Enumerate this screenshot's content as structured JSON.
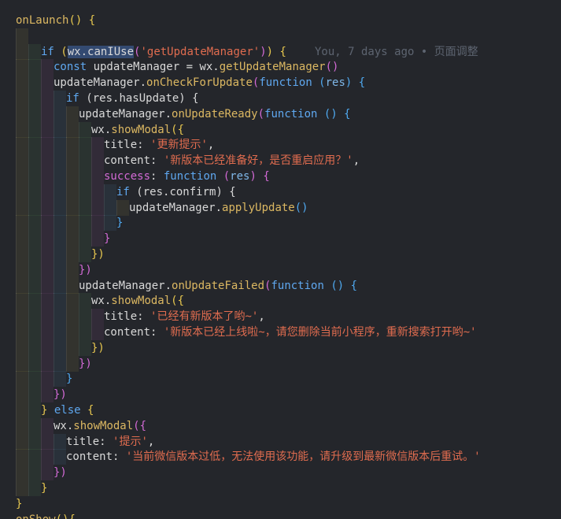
{
  "blame": "You, 7 days ago • 页面调整",
  "lines": [
    [
      [
        "onLaunch",
        "fn"
      ],
      [
        "() {",
        "br1"
      ]
    ],
    [],
    [
      [
        "if ",
        "kw"
      ],
      [
        "(",
        "br1"
      ],
      [
        "wx.canIUse",
        "sel"
      ],
      [
        "(",
        "br2"
      ],
      [
        "'getUpdateManager'",
        "str"
      ],
      [
        ")",
        "br2"
      ],
      [
        ") {",
        "br1"
      ]
    ],
    [
      [
        "const ",
        "kw"
      ],
      [
        "updateManager ",
        "var"
      ],
      [
        "= ",
        "var"
      ],
      [
        "wx.",
        "var"
      ],
      [
        "getUpdateManager",
        "fn"
      ],
      [
        "()",
        "br2"
      ]
    ],
    [
      [
        "updateManager.",
        "var"
      ],
      [
        "onCheckForUpdate",
        "fn"
      ],
      [
        "(",
        "br2"
      ],
      [
        "function ",
        "kw"
      ],
      [
        "(",
        "br3"
      ],
      [
        "res",
        "param"
      ],
      [
        ") {",
        "br3"
      ]
    ],
    [
      [
        "if ",
        "kw"
      ],
      [
        "(res.hasUpdate) {",
        "var"
      ]
    ],
    [
      [
        "updateManager.",
        "var"
      ],
      [
        "onUpdateReady",
        "fn"
      ],
      [
        "(",
        "br2"
      ],
      [
        "function ",
        "kw"
      ],
      [
        "() {",
        "br3"
      ]
    ],
    [
      [
        "wx.",
        "var"
      ],
      [
        "showModal",
        "fn"
      ],
      [
        "({",
        "br1"
      ]
    ],
    [
      [
        "title: ",
        "key"
      ],
      [
        "'更新提示'",
        "str"
      ],
      [
        ",",
        "var"
      ]
    ],
    [
      [
        "content: ",
        "key"
      ],
      [
        "'新版本已经准备好，是否重启应用？'",
        "str"
      ],
      [
        ",",
        "var"
      ]
    ],
    [
      [
        "success",
        "succ"
      ],
      [
        ": ",
        "var"
      ],
      [
        "function ",
        "kw"
      ],
      [
        "(",
        "br2"
      ],
      [
        "res",
        "param"
      ],
      [
        ") {",
        "br2"
      ]
    ],
    [
      [
        "if ",
        "kw"
      ],
      [
        "(res.confirm) {",
        "var"
      ]
    ],
    [
      [
        "updateManager.",
        "var"
      ],
      [
        "applyUpdate",
        "fn"
      ],
      [
        "()",
        "br3"
      ]
    ],
    [
      [
        "}",
        "br3"
      ]
    ],
    [
      [
        "}",
        "br2"
      ]
    ],
    [
      [
        "})",
        "br1"
      ]
    ],
    [
      [
        "})",
        "br2"
      ]
    ],
    [
      [
        "updateManager.",
        "var"
      ],
      [
        "onUpdateFailed",
        "fn"
      ],
      [
        "(",
        "br2"
      ],
      [
        "function ",
        "kw"
      ],
      [
        "() {",
        "br3"
      ]
    ],
    [
      [
        "wx.",
        "var"
      ],
      [
        "showModal",
        "fn"
      ],
      [
        "({",
        "br1"
      ]
    ],
    [
      [
        "title: ",
        "key"
      ],
      [
        "'已经有新版本了哟~'",
        "str"
      ],
      [
        ",",
        "var"
      ]
    ],
    [
      [
        "content: ",
        "key"
      ],
      [
        "'新版本已经上线啦~，请您删除当前小程序，重新搜索打开哟~'",
        "str"
      ]
    ],
    [
      [
        "})",
        "br1"
      ]
    ],
    [
      [
        "})",
        "br2"
      ]
    ],
    [
      [
        "}",
        "br3"
      ]
    ],
    [
      [
        "})",
        "br2"
      ]
    ],
    [
      [
        "} ",
        "br1"
      ],
      [
        "else ",
        "kw"
      ],
      [
        "{",
        "br1"
      ]
    ],
    [
      [
        "wx.",
        "var"
      ],
      [
        "showModal",
        "fn"
      ],
      [
        "({",
        "br2"
      ]
    ],
    [
      [
        "title: ",
        "key"
      ],
      [
        "'提示'",
        "str"
      ],
      [
        ",",
        "var"
      ]
    ],
    [
      [
        "content: ",
        "key"
      ],
      [
        "'当前微信版本过低，无法使用该功能，请升级到最新微信版本后重试。'",
        "str"
      ]
    ],
    [
      [
        "})",
        "br2"
      ]
    ],
    [
      [
        "}",
        "br1"
      ]
    ],
    [
      [
        "}",
        "br1"
      ]
    ],
    [
      [
        "onShow",
        "fn"
      ],
      [
        "(){",
        "br1"
      ]
    ]
  ]
}
